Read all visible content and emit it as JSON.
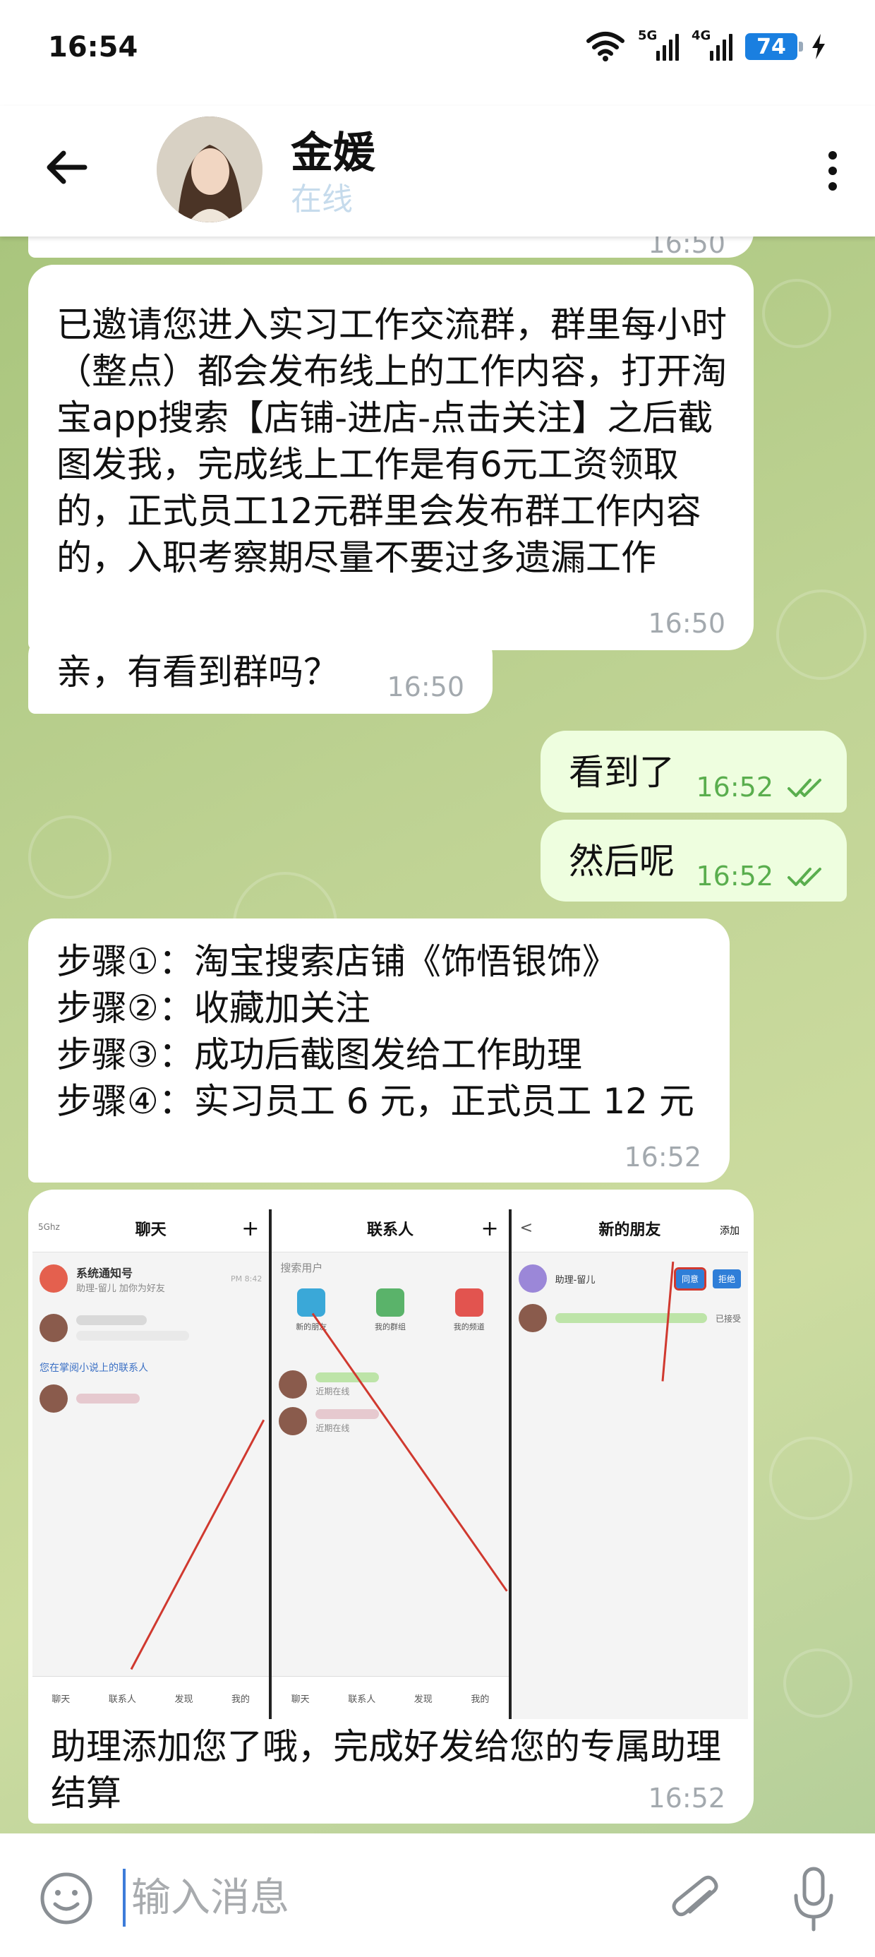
{
  "status_bar": {
    "time": "16:54",
    "network_1": "5G",
    "network_2": "4G",
    "battery": "74"
  },
  "header": {
    "name": "金媛",
    "status": "在线"
  },
  "messages": [
    {
      "direction": "in",
      "text": "已邀请您进入实习工作交流群，群里每小时（整点）都会发布线上的工作内容，打开淘宝app搜索【店铺-进店-点击关注】之后截图发我，完成线上工作是有6元工资领取的，正式员工12元群里会发布群工作内容的，入职考察期尽量不要过多遗漏工作",
      "time": "16:50"
    },
    {
      "direction": "in",
      "text": "亲，有看到群吗？",
      "time": "16:50"
    },
    {
      "direction": "out",
      "text": "看到了",
      "time": "16:52",
      "read": true
    },
    {
      "direction": "out",
      "text": "然后呢",
      "time": "16:52",
      "read": true
    },
    {
      "direction": "in",
      "lines": [
        "步骤①：淘宝搜索店铺《饰悟银饰》",
        "步骤②：收藏加关注",
        "步骤③：成功后截图发给工作助理",
        "步骤④：实习员工 6 元，正式员工 12 元"
      ],
      "time": "16:52"
    },
    {
      "direction": "in",
      "image": {
        "panel_1": {
          "title": "聊天",
          "status": "5Ghz",
          "plus": "+",
          "row_1_name": "系统通知号",
          "row_1_sub": "助理-留儿 加你为好友",
          "row_1_time": "PM 8:42",
          "section_label": "您在掌阅小说上的联系人",
          "tabs": [
            "聊天",
            "联系人",
            "发现",
            "我的"
          ]
        },
        "panel_2": {
          "title": "联系人",
          "plus": "+",
          "search": "搜索用户",
          "shortcuts": [
            "新的朋友",
            "我的群组",
            "我的频道"
          ],
          "row_sub_1": "近期在线",
          "row_sub_2": "近期在线",
          "tabs": [
            "聊天",
            "联系人",
            "发现",
            "我的"
          ]
        },
        "panel_3": {
          "title": "新的朋友",
          "back": "<",
          "action": "添加",
          "request_name": "助理-留儿",
          "accept_label": "同意",
          "reject_label": "拒绝",
          "accepted_label": "已接受"
        }
      },
      "text": "助理添加您了哦，完成好发给您的专属助理结算",
      "time": "16:52"
    }
  ],
  "partial_time": "16:50",
  "composer": {
    "placeholder": "输入消息"
  },
  "colors": {
    "incoming_bubble": "#ffffff",
    "outgoing_bubble": "#eefedf",
    "outgoing_time": "#5aae4e",
    "accent": "#3d7cd9",
    "chat_background": "#bfd394"
  }
}
